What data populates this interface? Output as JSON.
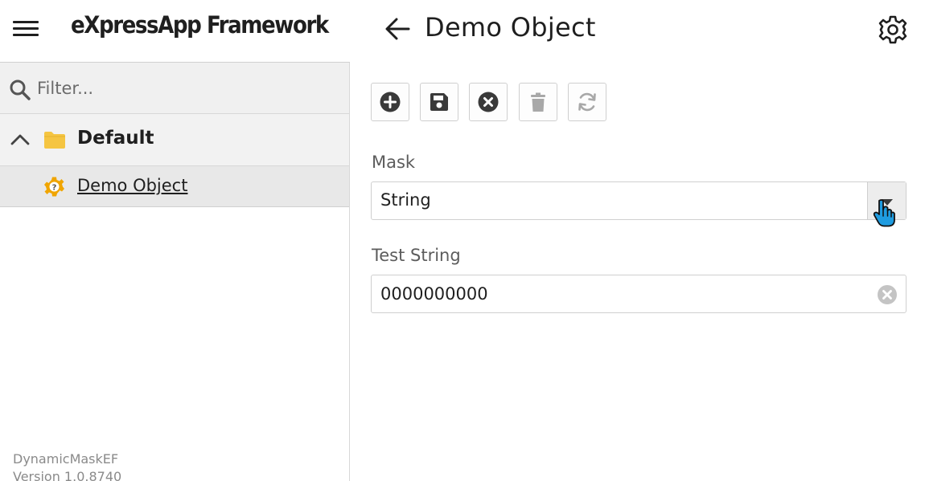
{
  "header": {
    "app_title": "eXpressApp Framework",
    "view_title": "Demo Object"
  },
  "sidebar": {
    "filter_placeholder": "Filter...",
    "group": {
      "label": "Default",
      "expanded": true
    },
    "items": [
      {
        "label": "Demo Object",
        "selected": true
      }
    ],
    "app_info": {
      "name": "DynamicMaskEF",
      "version": "Version 1.0.8740"
    }
  },
  "toolbar": {
    "buttons": [
      {
        "icon": "add-circle-icon",
        "enabled": true
      },
      {
        "icon": "save-icon",
        "enabled": true
      },
      {
        "icon": "cancel-circle-icon",
        "enabled": true
      },
      {
        "icon": "delete-icon",
        "enabled": false
      },
      {
        "icon": "refresh-icon",
        "enabled": false
      }
    ]
  },
  "form": {
    "mask": {
      "label": "Mask",
      "value": "String"
    },
    "test_string": {
      "label": "Test String",
      "value": "0000000000"
    }
  },
  "colors": {
    "accent_folder": "#f5c542",
    "icon_dark": "#3a3a3a",
    "icon_disabled": "#a8a8a8"
  }
}
